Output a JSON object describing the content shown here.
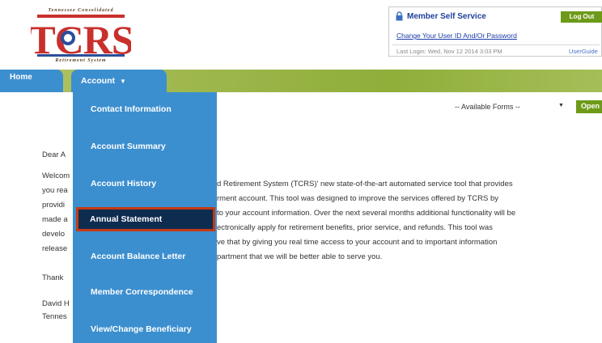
{
  "header": {
    "logo": {
      "top_text": "Tennessee Consolidated",
      "main_text": "TCRS",
      "bottom_text": "Retirement System"
    },
    "member_box": {
      "title": "Member Self Service",
      "logout_label": "Log Out",
      "change_link": "Change Your User ID And/Or Password",
      "last_login": "Last Login: Wed, Nov 12 2014 3:03 PM",
      "user_guide": "UserGuide"
    }
  },
  "nav": {
    "home_label": "Home",
    "account_label": "Account"
  },
  "dropdown": {
    "items": [
      {
        "label": "Contact Information"
      },
      {
        "label": "Account Summary"
      },
      {
        "label": "Account History"
      },
      {
        "label": "Annual Statement",
        "selected": true
      },
      {
        "label": "Account Balance Letter"
      },
      {
        "label": "Member Correspondence"
      },
      {
        "label": "View/Change Beneficiary"
      }
    ]
  },
  "forms": {
    "selected": "-- Available Forms --",
    "open_label": "Open"
  },
  "body": {
    "left_fragments": [
      "Dear A",
      "Welcom",
      "you rea",
      "providi",
      "made a",
      "develo",
      "release",
      "Thank",
      "David H",
      "Tennes"
    ],
    "right_lines": [
      "d Retirement System (TCRS)' new state-of-the-art automated service tool that provides",
      "rment account. This tool was designed to improve the services offered by TCRS by",
      "to your account information. Over the next several months additional functionality will be",
      "ectronically apply for retirement benefits, prior service, and refunds. This tool was",
      "ve that by giving you real time access to your account and to important information",
      "partment that we will be better able to serve you."
    ]
  },
  "colors": {
    "nav_blue": "#3c8fcf",
    "nav_green": "#8fae3a",
    "selected_bg": "#0e2c50",
    "selected_border": "#c43a14",
    "brand_red": "#c9302c",
    "brand_blue": "#2a4e9c"
  }
}
